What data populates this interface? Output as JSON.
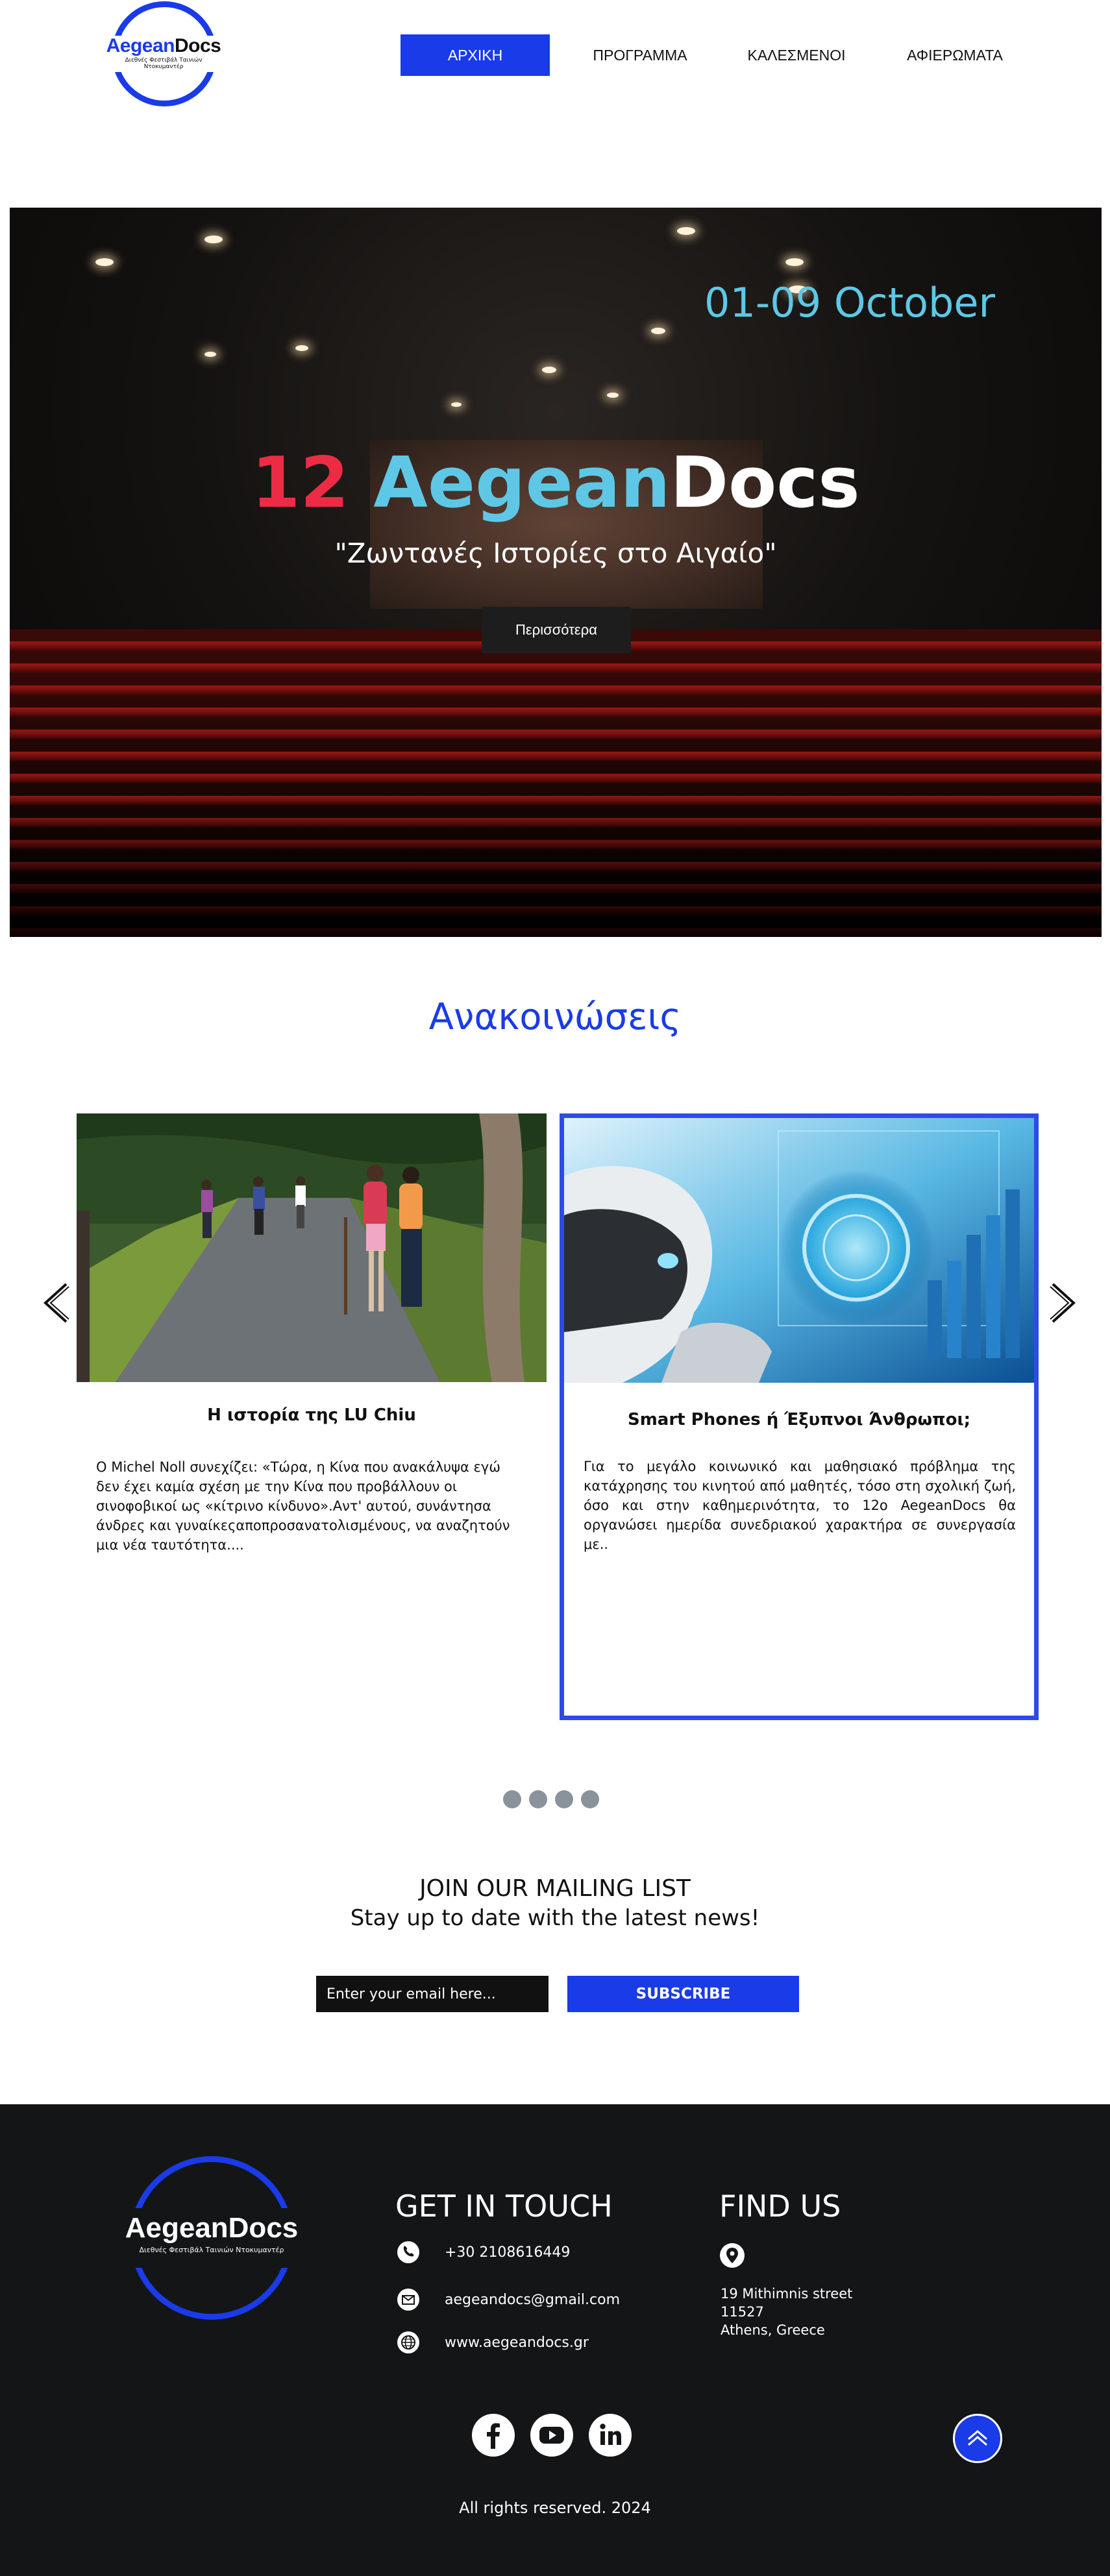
{
  "header": {
    "logo": {
      "name_part1": "Aegean",
      "name_part2": "Docs",
      "tagline": "Διεθνές Φεστιβάλ Ταινιών Ντοκυμαντέρ"
    },
    "nav": [
      {
        "label": "ΑΡΧΙΚΗ",
        "active": true
      },
      {
        "label": "ΠΡΟΓΡΑΜΜΑ",
        "active": false
      },
      {
        "label": "ΚΑΛΕΣΜΕΝΟΙ",
        "active": false
      },
      {
        "label": "ΑΦΙΕΡΩΜΑΤΑ",
        "active": false
      }
    ]
  },
  "hero": {
    "date": "01-09 October",
    "title_number": "12",
    "title_part1": "Aegean",
    "title_part2": "Docs",
    "subtitle": "\"Ζωντανές Ιστορίες στο Αιγαίο\"",
    "button_label": "Περισσότερα"
  },
  "announcements": {
    "title": "Ανακοινώσεις",
    "cards": [
      {
        "title": "Η ιστορία της LU Chiu",
        "text": "Ο Michel Noll συνεχίζει: «Τώρα, η Κίνα που ανακάλυψα εγώ δεν έχει καμία σχέση με την Κίνα που προβάλλουν οι σινοφοβικοί ως «κίτρινο κίνδυνο».Αντ' αυτού, συνάντησα άνδρες και γυναίκεςαποπροσανατολισμένους, να αναζητούν μια νέα ταυτότητα...."
      },
      {
        "title": "Smart Phones ή Έξυπνοι Άνθρωποι;",
        "text": "Για το μεγάλο κοινωνικό και μαθησιακό πρόβλημα της κατάχρησης του κινητού από μαθητές, τόσο στη σχολική ζωή, όσο και στην καθημερινότητα, το 12ο AegeanDocs θα οργανώσει ημερίδα συνεδριακού χαρακτήρα σε συνεργασία με.."
      }
    ],
    "pagination_count": 4
  },
  "mailing": {
    "title": "JOIN OUR MAILING LIST",
    "subtitle": "Stay up to date with the latest news!",
    "email_placeholder": "Enter your email here...",
    "subscribe_label": "SUBSCRIBE"
  },
  "footer": {
    "logo": {
      "name": "AegeanDocs",
      "tagline": "Διεθνές Φεστιβάλ Ταινιών Ντοκυμαντέρ"
    },
    "contact_heading": "GET IN TOUCH",
    "phone": "+30 2108616449",
    "email": "aegeandocs@gmail.com",
    "website": "www.aegeandocs.gr",
    "location_heading": "FIND US",
    "address_line1": "19 Mithimnis street",
    "address_line2": "11527",
    "address_line3": "Athens, Greece",
    "copyright": "All rights reserved. 2024"
  },
  "colors": {
    "brand_blue": "#1a3be8",
    "accent_cyan": "#5fc7e6",
    "accent_red": "#ee2b45",
    "footer_bg": "#141516"
  },
  "icons": [
    "phone-icon",
    "mail-icon",
    "globe-icon",
    "location-pin-icon",
    "facebook-icon",
    "youtube-icon",
    "linkedin-icon",
    "chevron-up-icon",
    "chevron-left-icon",
    "chevron-right-icon"
  ]
}
